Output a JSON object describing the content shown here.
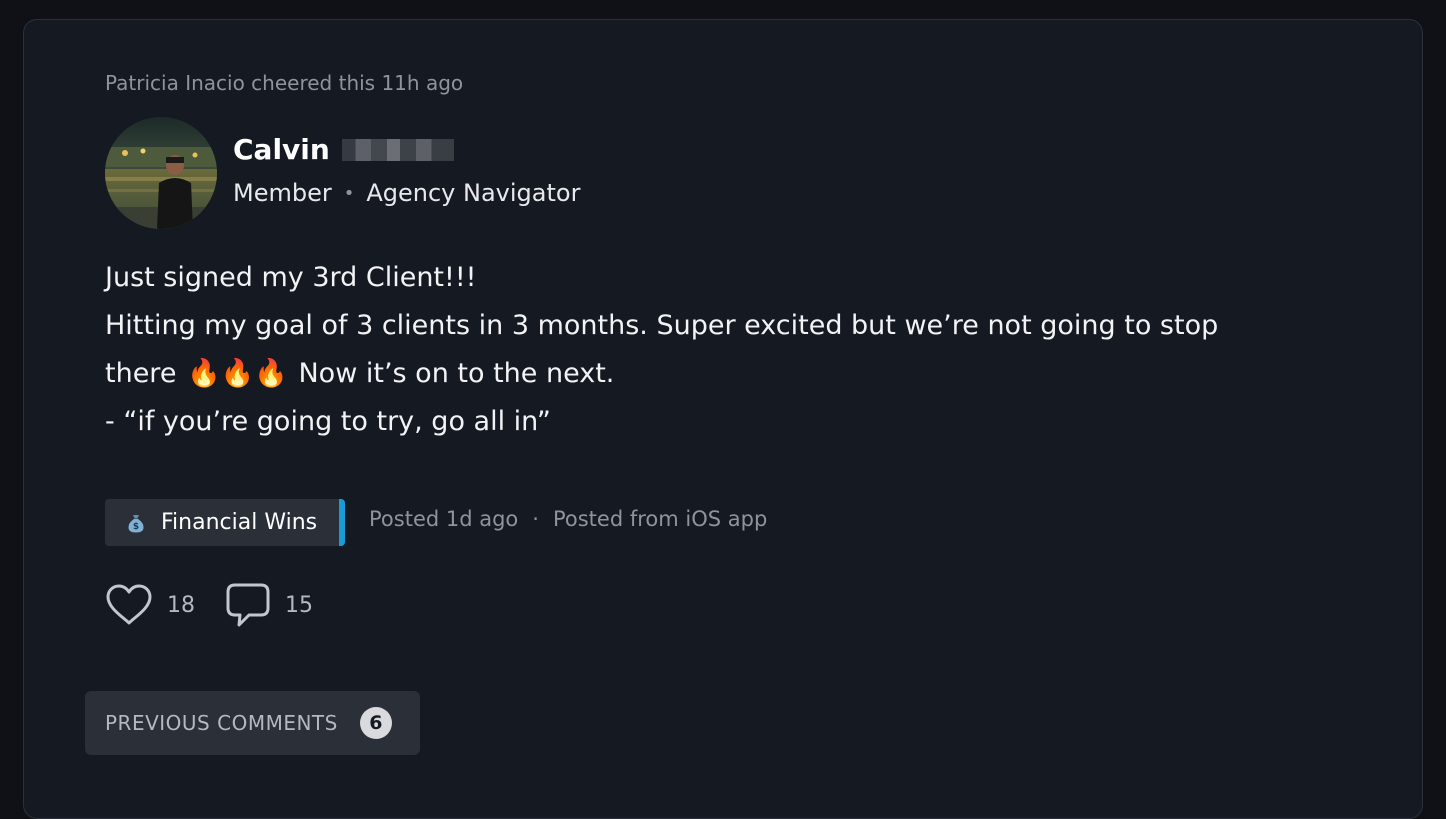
{
  "activity": {
    "cheer_line": "Patricia Inacio cheered this 11h ago"
  },
  "author": {
    "first_name": "Calvin",
    "role": "Member",
    "level": "Agency Navigator"
  },
  "post": {
    "line1": "Just signed my 3rd Client!!!",
    "line2": "Hitting my goal of 3 clients in 3 months. Super excited but we’re not going to stop",
    "line3_start": "there",
    "fires": "🔥🔥🔥",
    "line3_end": "Now it’s on to the next.",
    "line4": "- “if you’re going to try, go all in”"
  },
  "category": {
    "icon": "money-bag-icon",
    "label": "Financial Wins",
    "accent_color": "#1a9bd7"
  },
  "meta": {
    "posted": "Posted 1d ago",
    "separator": "·",
    "source": "Posted from iOS app"
  },
  "reactions": {
    "likes": "18",
    "comments": "15"
  },
  "comments": {
    "previous_label": "PREVIOUS COMMENTS",
    "previous_count": "6"
  }
}
